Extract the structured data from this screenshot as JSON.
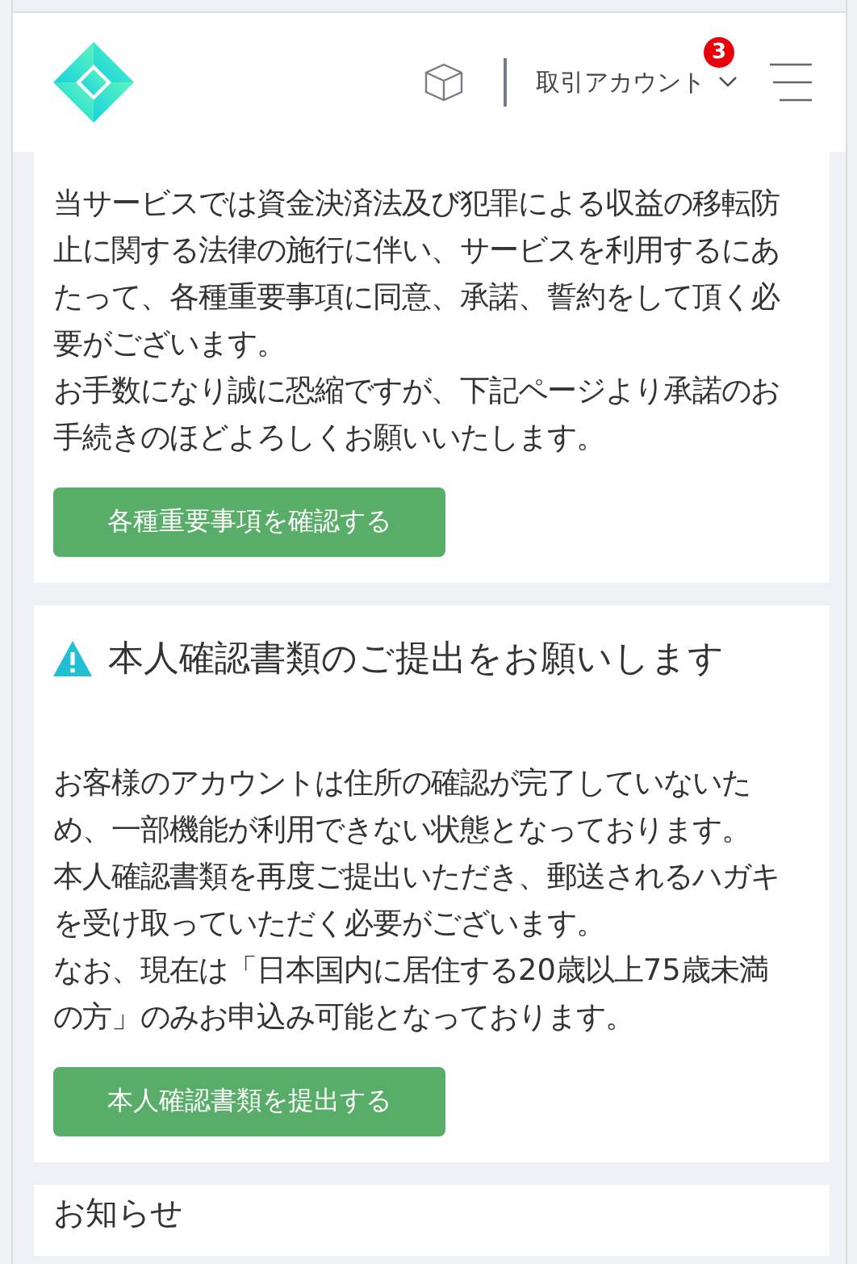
{
  "header": {
    "account_label": "取引アカウント",
    "notification_count": "3"
  },
  "cards": [
    {
      "paragraphs": [
        "当サービスでは資金決済法及び犯罪による収益の移転防止に関する法律の施行に伴い、サービスを利用するにあたって、各種重要事項に同意、承諾、誓約をして頂く必要がございます。",
        "お手数になり誠に恐縮ですが、下記ページより承諾のお手続きのほどよろしくお願いいたします。"
      ],
      "button": "各種重要事項を確認する"
    },
    {
      "title": "本人確認書類のご提出をお願いします",
      "paragraphs": [
        "お客様のアカウントは住所の確認が完了していないため、一部機能が利用できない状態となっております。",
        "本人確認書類を再度ご提出いただき、郵送されるハガキを受け取っていただく必要がございます。",
        "なお、現在は「日本国内に居住する20歳以上75歳未満の方」のみお申込み可能となっております。"
      ],
      "button": "本人確認書類を提出する"
    },
    {
      "title": "お知らせ"
    }
  ]
}
